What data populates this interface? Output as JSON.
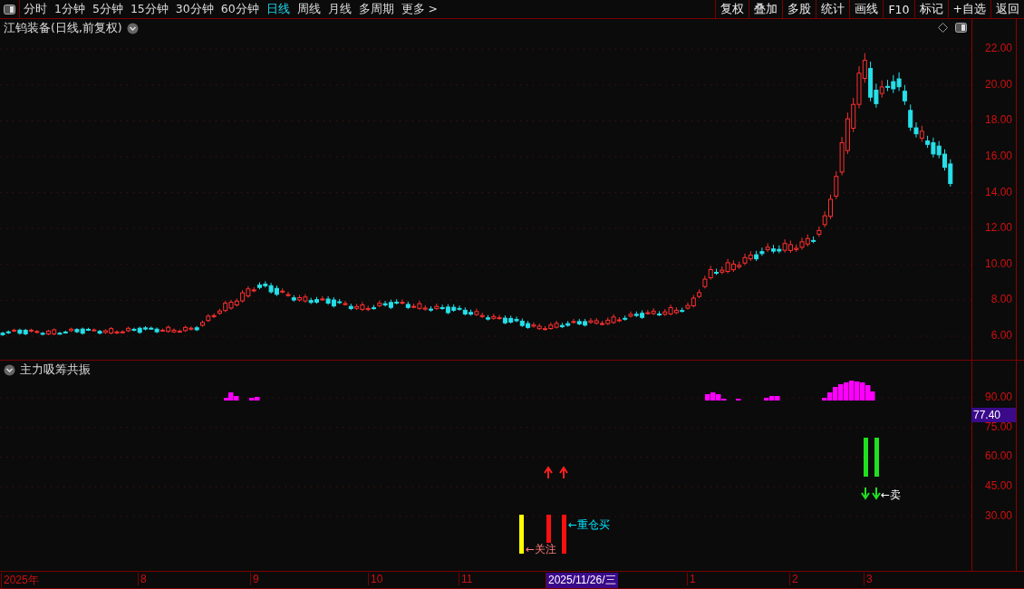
{
  "toolbar": {
    "periods": [
      {
        "label": "分时",
        "selected": false
      },
      {
        "label": "1分钟",
        "selected": false
      },
      {
        "label": "5分钟",
        "selected": false
      },
      {
        "label": "15分钟",
        "selected": false
      },
      {
        "label": "30分钟",
        "selected": false
      },
      {
        "label": "60分钟",
        "selected": false
      },
      {
        "label": "日线",
        "selected": true
      },
      {
        "label": "周线",
        "selected": false
      },
      {
        "label": "月线",
        "selected": false
      },
      {
        "label": "多周期",
        "selected": false
      },
      {
        "label": "更多 >",
        "selected": false
      }
    ],
    "buttons": [
      "复权",
      "叠加",
      "多股",
      "统计",
      "画线",
      "F10",
      "标记",
      "+自选",
      "返回"
    ]
  },
  "price_panel": {
    "title": "江钨装备(日线,前复权)",
    "y_ticks": [
      "22.00",
      "20.00",
      "18.00",
      "16.00",
      "14.00",
      "12.00",
      "10.00",
      "8.00",
      "6.00"
    ]
  },
  "indicator_panel": {
    "title": "主力吸筹共振",
    "y_ticks": [
      "90.00",
      "75.00",
      "60.00",
      "45.00",
      "30.00"
    ],
    "current_value": "77.40",
    "signals": [
      {
        "label": "←关注",
        "color": "#ff7a7a"
      },
      {
        "label": "←重仓买",
        "color": "#00e5ff"
      },
      {
        "label": "←卖",
        "color": "#ffffff"
      }
    ]
  },
  "x_axis": {
    "labels": [
      "2025年",
      "8",
      "9",
      "10",
      "11",
      "2025/11/26/三",
      "1",
      "2",
      "3"
    ]
  }
}
